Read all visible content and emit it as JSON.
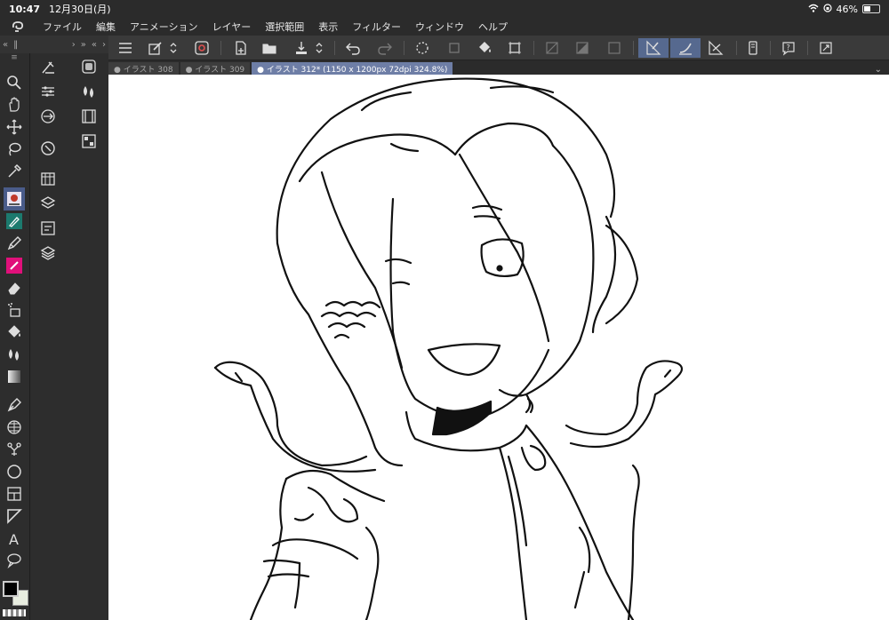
{
  "status": {
    "time": "10:47",
    "date": "12月30日(月)",
    "battery": "46%",
    "battery_level": 0.46
  },
  "menu": [
    "ファイル",
    "編集",
    "アニメーション",
    "レイヤー",
    "選択範囲",
    "表示",
    "フィルター",
    "ウィンドウ",
    "ヘルプ"
  ],
  "tabs": [
    {
      "label": "● イラスト 308"
    },
    {
      "label": "● イラスト 309"
    },
    {
      "label": "● イラスト 312* (1150 x 1200px 72dpi 324.8%)"
    }
  ],
  "colors": {
    "main": "#000000",
    "sub": "#e8ede0",
    "accent": "#56698f"
  },
  "tools": [
    "zoom-icon",
    "hand-icon",
    "move-icon",
    "lasso-icon",
    "eyedropper-icon",
    "brush-preview-icon",
    "pen-icon",
    "pencil-icon",
    "marker-icon",
    "eraser-icon",
    "airbrush-icon",
    "fill-icon",
    "blend-icon",
    "gradient-icon",
    "vector-pen-icon",
    "frame-icon",
    "ruler-icon",
    "ellipse-icon",
    "panel-icon",
    "line-icon",
    "text-icon",
    "balloon-icon"
  ]
}
